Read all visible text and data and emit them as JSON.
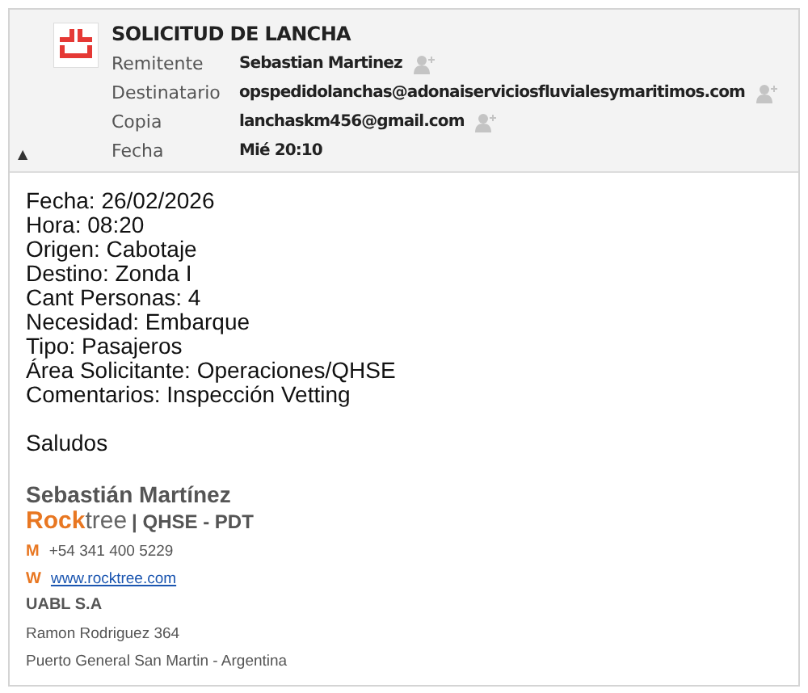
{
  "header": {
    "title": "SOLICITUD DE LANCHA",
    "toggle": "▲",
    "fields": [
      {
        "label": "Remitente",
        "value": "Sebastian Martinez",
        "add_contact": true
      },
      {
        "label": "Destinatario",
        "value": "opspedidolanchas@adonaiserviciosfluvialesymaritimos.com",
        "add_contact": true
      },
      {
        "label": "Copia",
        "value": "lanchaskm456@gmail.com",
        "add_contact": true
      },
      {
        "label": "Fecha",
        "value": "Mié 20:10",
        "add_contact": false
      }
    ]
  },
  "body": {
    "lines": [
      "Fecha: 26/02/2026",
      "Hora: 08:20",
      "Origen: Cabotaje",
      "Destino: Zonda I",
      "Cant Personas: 4",
      "Necesidad: Embarque",
      "Tipo: Pasajeros",
      "Área Solicitante: Operaciones/QHSE",
      "Comentarios: Inspección Vetting"
    ],
    "closing": "Saludos"
  },
  "signature": {
    "name": "Sebastián Martínez",
    "brand_bold": "Rock",
    "brand_rest": "tree",
    "role": "| QHSE - PDT",
    "contacts": [
      {
        "key": "M",
        "value": "+54 341 400 5229",
        "kind": "phone"
      },
      {
        "key": "W",
        "value": "www.rocktree.com",
        "kind": "link"
      }
    ],
    "org": "UABL S.A",
    "address": [
      "Ramon Rodriguez 364",
      "Puerto General San Martin - Argentina"
    ]
  }
}
